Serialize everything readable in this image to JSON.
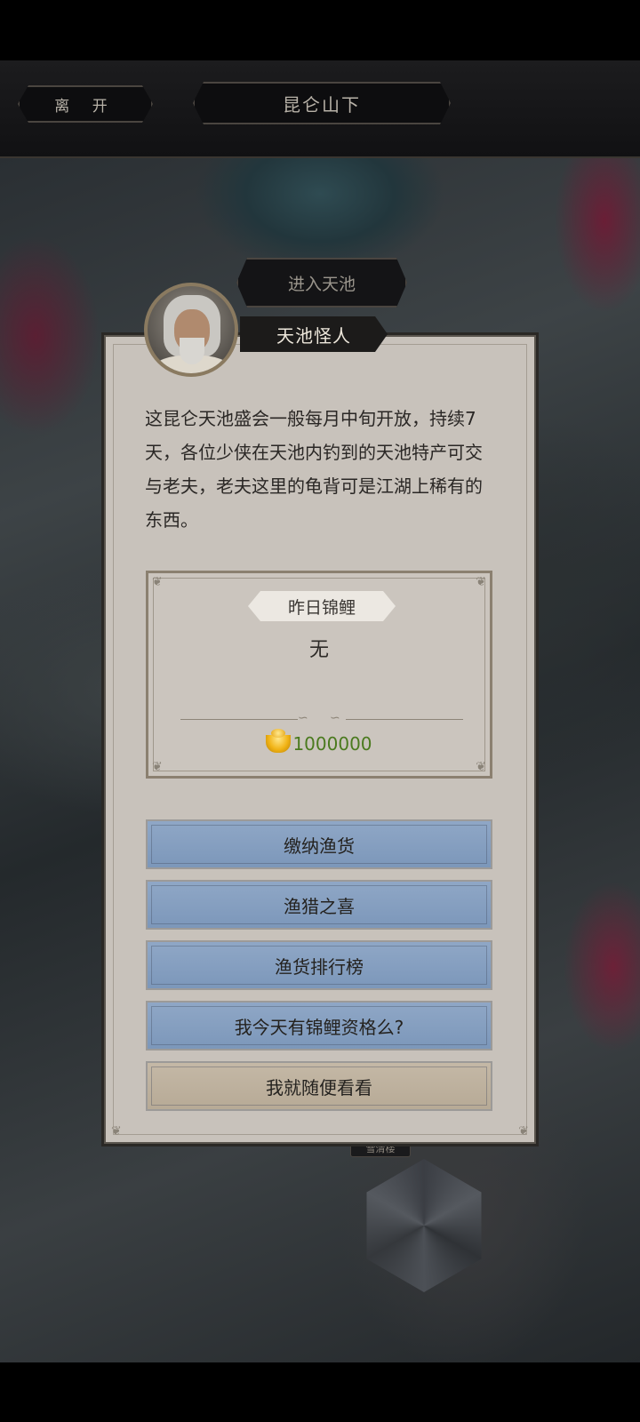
{
  "topbar": {
    "leave_label": "离 开",
    "location_title": "昆仑山下"
  },
  "scene": {
    "enter_label": "进入天池",
    "pavilion_label": "雪清楼"
  },
  "npc": {
    "name": "天池怪人",
    "dialog": "这昆仑天池盛会一般每月中旬开放，持续7天，各位少侠在天池内钓到的天池特产可交与老夫，老夫这里的龟背可是江湖上稀有的东西。"
  },
  "koi": {
    "tag": "昨日锦鲤",
    "winner": "无",
    "reward_icon": "gold-ingot-icon",
    "reward_amount": "1000000"
  },
  "options": [
    {
      "label": "缴纳渔货",
      "style": "blue"
    },
    {
      "label": "渔猎之喜",
      "style": "blue"
    },
    {
      "label": "渔货排行榜",
      "style": "blue"
    },
    {
      "label": "我今天有锦鲤资格么?",
      "style": "blue"
    },
    {
      "label": "我就随便看看",
      "style": "tan"
    }
  ],
  "colors": {
    "panel": "#c8c2bb",
    "option_blue": "#8fa7c6",
    "option_tan": "#c4b8a6",
    "reward_green": "#4a7a1e"
  }
}
